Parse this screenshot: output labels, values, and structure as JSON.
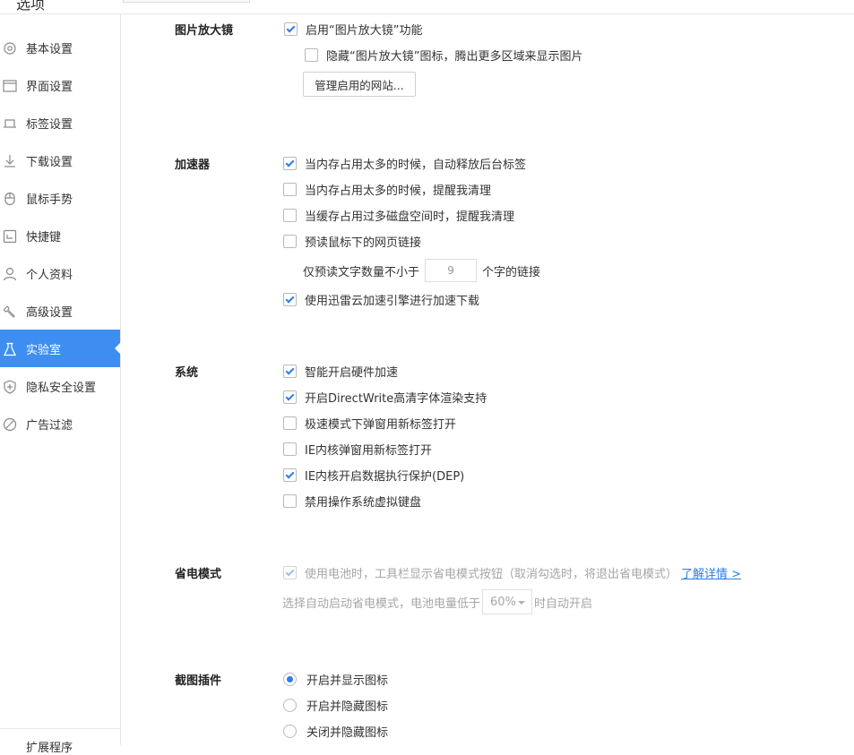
{
  "window": {
    "title_fragment": "选项"
  },
  "sidebar": {
    "items": [
      {
        "label": "基本设置",
        "icon": "gear-icon"
      },
      {
        "label": "界面设置",
        "icon": "window-icon"
      },
      {
        "label": "标签设置",
        "icon": "tab-icon"
      },
      {
        "label": "下载设置",
        "icon": "download-icon"
      },
      {
        "label": "鼠标手势",
        "icon": "mouse-icon"
      },
      {
        "label": "快捷键",
        "icon": "keyboard-icon"
      },
      {
        "label": "个人资料",
        "icon": "user-icon"
      },
      {
        "label": "高级设置",
        "icon": "wrench-icon"
      },
      {
        "label": "实验室",
        "icon": "flask-icon",
        "active": true
      },
      {
        "label": "隐私安全设置",
        "icon": "shield-icon"
      },
      {
        "label": "广告过滤",
        "icon": "block-icon"
      }
    ],
    "bottom_label": "扩展程序"
  },
  "sections": {
    "magnifier": {
      "title": "图片放大镜",
      "enable_label": "启用“图片放大镜”功能",
      "hide_icon_label": "隐藏“图片放大镜”图标，腾出更多区域来显示图片",
      "manage_button": "管理启用的网站..."
    },
    "accelerator": {
      "title": "加速器",
      "opt1": "当内存占用太多的时候，自动释放后台标签",
      "opt2": "当内存占用太多的时候，提醒我清理",
      "opt3": "当缓存占用过多磁盘空间时，提醒我清理",
      "opt4": "预读鼠标下的网页链接",
      "preread_prefix": "仅预读文字数量不小于",
      "preread_value": "9",
      "preread_suffix": "个字的链接",
      "opt5": "使用迅雷云加速引擎进行加速下载"
    },
    "system": {
      "title": "系统",
      "opt1": "智能开启硬件加速",
      "opt2": "开启DirectWrite高清字体渲染支持",
      "opt3": "极速模式下弹窗用新标签打开",
      "opt4": "IE内核弹窗用新标签打开",
      "opt5": "IE内核开启数据执行保护(DEP)",
      "opt6": "禁用操作系统虚拟键盘"
    },
    "power": {
      "title": "省电模式",
      "battery_label": "使用电池时，工具栏显示省电模式按钮（取消勾选时，将退出省电模式）",
      "learn_more": "了解详情 >",
      "auto_prefix": "选择自动启动省电模式，电池电量低于",
      "auto_value": "60%",
      "auto_suffix": "时自动开启"
    },
    "screenshot": {
      "title": "截图插件",
      "radio1": "开启并显示图标",
      "radio2": "开启并隐藏图标",
      "radio3": "关闭并隐藏图标"
    }
  },
  "colors": {
    "accent": "#3d8ef0",
    "check": "#2b7de9",
    "disabled_text": "#a6a6a6"
  }
}
